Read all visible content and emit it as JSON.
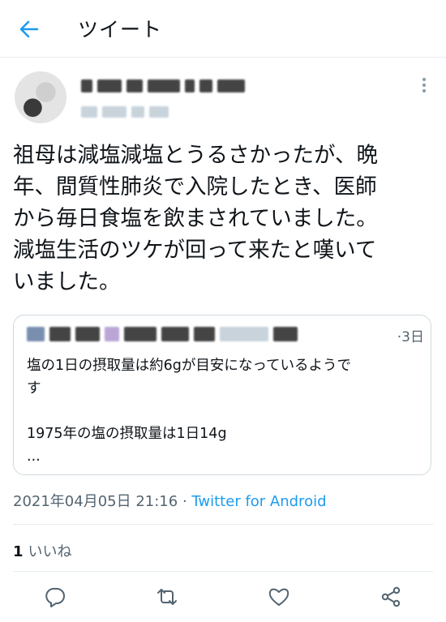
{
  "header": {
    "title": "ツイート"
  },
  "tweet": {
    "text": "祖母は減塩減塩とうるさかったが、晩\n年、間質性肺炎で入院したとき、医師\nから毎日食塩を飲まされていました。\n減塩生活のツケが回って来たと嘆いて\nいました。",
    "timestamp": "2021年04月05日 21:16",
    "separator": " · ",
    "source": "Twitter for Android"
  },
  "quote": {
    "time": "3日",
    "time_separator": "·",
    "line1": "塩の1日の摂取量は約6gが目安になっているようで",
    "line2": "す",
    "line3": "1975年の塩の摂取量は1日14g",
    "line4": "..."
  },
  "likes": {
    "count": "1",
    "label": "いいね"
  },
  "icons": {
    "back": "arrow-left-icon",
    "more": "more-vertical-icon",
    "reply": "reply-icon",
    "retweet": "retweet-icon",
    "like": "heart-icon",
    "share": "share-icon"
  },
  "colors": {
    "accent": "#1d9bf0",
    "secondary": "#536471",
    "icon": "#536471"
  }
}
